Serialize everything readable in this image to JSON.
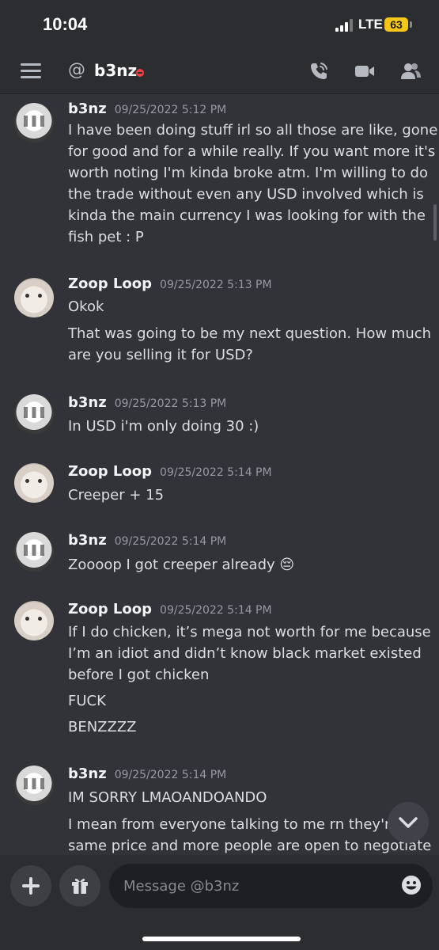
{
  "status_bar": {
    "time": "10:04",
    "network": "LTE",
    "battery": "63"
  },
  "header": {
    "at_symbol": "@",
    "title": "b3nz"
  },
  "messages": [
    {
      "author": "b3nz",
      "timestamp": "09/25/2022 5:12 PM",
      "avatar": "b3nz",
      "lines": [
        "I have been doing stuff irl so all those are like, gone",
        "for good and for a while really. If you want more it's",
        "worth noting I'm kinda broke atm. I'm willing to do",
        "the trade without even any USD involved which is",
        "kinda the main currency I was looking for with the",
        "fish pet : P"
      ]
    },
    {
      "author": "Zoop Loop",
      "timestamp": "09/25/2022 5:13 PM",
      "avatar": "zoop",
      "lines": [
        "Okok",
        "That was going to be my next question. How much",
        "are you selling it for USD?"
      ]
    },
    {
      "author": "b3nz",
      "timestamp": "09/25/2022 5:13 PM",
      "avatar": "b3nz",
      "lines": [
        "In USD i'm only doing 30 :)"
      ]
    },
    {
      "author": "Zoop Loop",
      "timestamp": "09/25/2022 5:14 PM",
      "avatar": "zoop",
      "lines": [
        "Creeper + 15"
      ]
    },
    {
      "author": "b3nz",
      "timestamp": "09/25/2022 5:14 PM",
      "avatar": "b3nz",
      "lines": [
        "Zoooop I got creeper already 😔"
      ]
    },
    {
      "author": "Zoop Loop",
      "timestamp": "09/25/2022 5:14 PM",
      "avatar": "zoop",
      "lines": [
        "If I do chicken, it’s mega not worth for me because",
        "I’m an idiot and didn’t know black market existed",
        "before I got chicken",
        "FUCK",
        "BENZZZZ"
      ]
    },
    {
      "author": "b3nz",
      "timestamp": "09/25/2022 5:14 PM",
      "avatar": "b3nz",
      "lines": [
        "IM SORRY LMAOANDOANDO",
        "I mean from everyone talking to me rn they're l",
        "same price and more people are open to negotiate"
      ]
    }
  ],
  "composer": {
    "placeholder": "Message @b3nz"
  },
  "icons": {
    "menu": "hamburger-menu-icon",
    "call": "phone-call-icon",
    "video": "video-camera-icon",
    "members": "members-icon",
    "add": "plus-icon",
    "gift": "gift-icon",
    "emoji": "emoji-icon",
    "jump": "chevron-down-icon"
  },
  "colors": {
    "background": "#313338",
    "header": "#2b2d31",
    "dnd": "#f23f43",
    "battery": "#f5c518"
  }
}
